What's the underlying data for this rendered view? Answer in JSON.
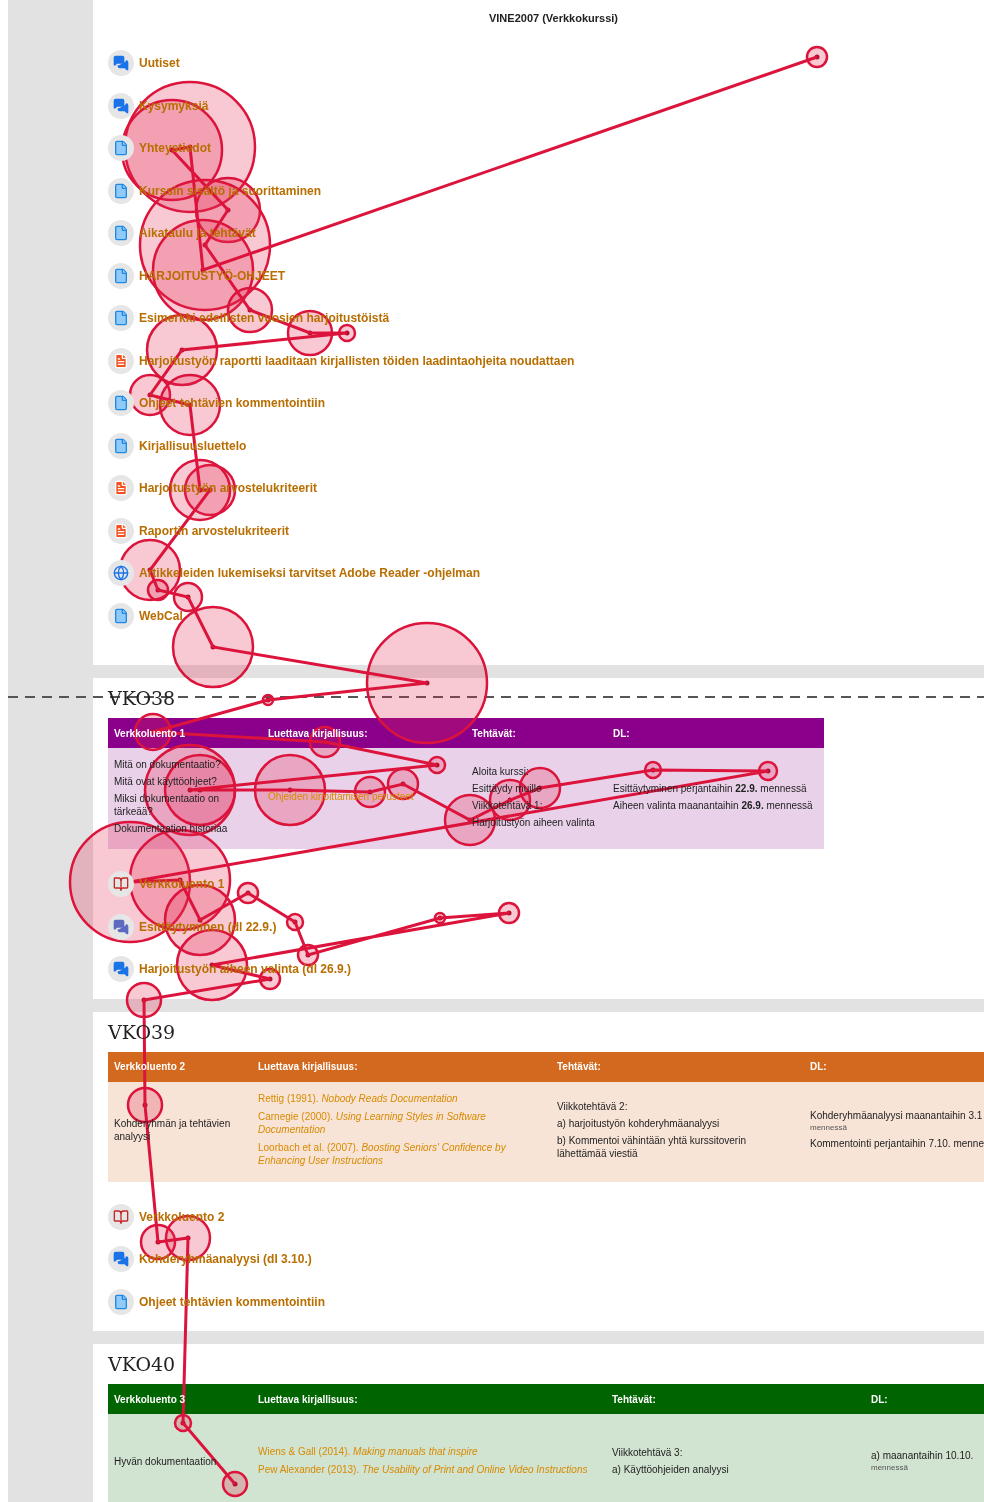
{
  "page_title": "VINE2007 (Verkkokurssi)",
  "intro_links": [
    {
      "kind": "forum",
      "label": "Uutiset"
    },
    {
      "kind": "forum",
      "label": "Kysymyksiä"
    },
    {
      "kind": "file",
      "label": "Yhteystiedot"
    },
    {
      "kind": "file",
      "label": "Kurssin sisältö ja suorittaminen"
    },
    {
      "kind": "file",
      "label": "Aikataulu ja tehtävät"
    },
    {
      "kind": "file",
      "label": "HARJOITUSTYÖ-OHJEET"
    },
    {
      "kind": "file",
      "label": "Esimerkki edellisten vuosien harjoitustöistä"
    },
    {
      "kind": "pdf",
      "label": "Harjoitustyön raportti laaditaan kirjallisten töiden laadintaohjeita noudattaen"
    },
    {
      "kind": "file",
      "label": "Ohjeet tehtävien kommentointiin"
    },
    {
      "kind": "file",
      "label": "Kirjallisuusluettelo"
    },
    {
      "kind": "pdf",
      "label": "Harjoitustyön arvostelukriteerit"
    },
    {
      "kind": "pdf",
      "label": "Raportin arvostelukriteerit"
    },
    {
      "kind": "globe",
      "label": "Artikkeleiden lukemiseksi tarvitset Adobe Reader -ohjelman"
    },
    {
      "kind": "file",
      "label": "WebCal"
    }
  ],
  "weeks": [
    {
      "heading": "VKO38",
      "color": "#8b008b",
      "columns": [
        "Verkkoluento 1",
        "Luettava kirjallisuus:",
        "Tehtävät:",
        "DL:"
      ],
      "cells": [
        [
          {
            "kind": "text",
            "text": "Mitä on dokumentaatio?"
          },
          {
            "kind": "text",
            "text": "Mitä ovat käyttöohjeet?"
          },
          {
            "kind": "text",
            "text": "Miksi dokumentaatio on tärkeää?"
          },
          {
            "kind": "text",
            "text": "Dokumentaation historiaa"
          }
        ],
        [
          {
            "kind": "link",
            "text": "Ohjeiden kirjoittamisen perusteet"
          }
        ],
        [
          {
            "kind": "text",
            "text": "Aloita kurssi:"
          },
          {
            "kind": "text",
            "text": "Esittäydy muille"
          },
          {
            "kind": "text",
            "text": "Viikkotehtävä 1:"
          },
          {
            "kind": "text",
            "text": "Harjoitustyön aiheen valinta"
          }
        ],
        [
          {
            "kind": "text",
            "text": "Esittäytyminen perjantaihin **22.9.** mennessä"
          },
          {
            "kind": "text",
            "text": "Aiheen valinta maanantaihin **26.9.** mennessä"
          }
        ]
      ],
      "links": [
        {
          "kind": "book",
          "label": "Verkkoluento 1"
        },
        {
          "kind": "chat",
          "label": "Esittäytyminen (dl 22.9.)"
        },
        {
          "kind": "forum",
          "label": "Harjoitustyön aiheen valinta (dl 26.9.)"
        }
      ]
    },
    {
      "heading": "VKO39",
      "color": "#d2691e",
      "columns": [
        "Verkkoluento 2",
        "Luettava kirjallisuus:",
        "Tehtävät:",
        "DL:"
      ],
      "cells": [
        [
          {
            "kind": "text",
            "text": "Kohderyhmän ja tehtävien analyysi"
          }
        ],
        [
          {
            "kind": "link",
            "text": "Rettig (1991). *Nobody Reads Documentation*"
          },
          {
            "kind": "link",
            "text": "Carnegie (2000). *Using Learning Styles in Software Documentation*"
          },
          {
            "kind": "link",
            "text": "Loorbach et al. (2007). *Boosting Seniors' Confidence by Enhancing User Instructions*"
          }
        ],
        [
          {
            "kind": "text",
            "text": "Viikkotehtävä 2:"
          },
          {
            "kind": "text",
            "text": "a) harjoitustyön kohderyhmäanalyysi"
          },
          {
            "kind": "text",
            "text": "b) Kommentoi vähintään yhtä kurssitoverin lähettämää viestiä"
          }
        ],
        [
          {
            "kind": "text",
            "text": "Kohderyhmäanalyysi maanantaihin 3.1"
          },
          {
            "kind": "note",
            "text": "mennessä"
          },
          {
            "kind": "text",
            "text": "Kommentointi perjantaihin 7.10. menne"
          }
        ]
      ],
      "links": [
        {
          "kind": "book",
          "label": "Verkkoluento 2"
        },
        {
          "kind": "forum",
          "label": "Kohderyhmäanalyysi (dl 3.10.)"
        },
        {
          "kind": "file",
          "label": "Ohjeet tehtävien kommentointiin"
        }
      ]
    },
    {
      "heading": "VKO40",
      "color": "#006400",
      "columns": [
        "Verkkoluento 3",
        "Luettava kirjallisuus:",
        "Tehtävät:",
        "DL:"
      ],
      "cells": [
        [
          {
            "kind": "text",
            "text": "Hyvän dokumentaation"
          }
        ],
        [
          {
            "kind": "link",
            "text": "Wiens & Gall (2014). *Making manuals that inspire*"
          },
          {
            "kind": "link",
            "text": "Pew Alexander (2013). *The Usability of Print and Online Video Instructions*"
          }
        ],
        [
          {
            "kind": "text",
            "text": "Viikkotehtävä 3:"
          },
          {
            "kind": "text",
            "text": "a) Käyttöohjeiden analyysi"
          }
        ],
        [
          {
            "kind": "text",
            "text": "a) maanantaihin 10.10."
          },
          {
            "kind": "note",
            "text": "mennessä"
          }
        ]
      ]
    }
  ]
}
